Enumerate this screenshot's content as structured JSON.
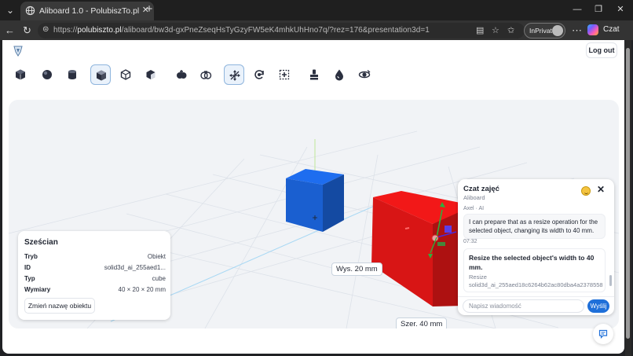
{
  "browser": {
    "tab_title": "Aliboard 1.0 - PolubiszTo.pl",
    "url_host": "polubiszto.pl",
    "url_prefix": "https://",
    "url_path": "/aliboard/bw3d-gxPneZseqHsTyGzyFW5eK4mhkUhHno7q/?rez=176&presentation3d=1",
    "inprivate_label": "InPrivate",
    "copilot_label": "Czat"
  },
  "header": {
    "logout_label": "Log out"
  },
  "toolbar": {
    "tools": [
      {
        "name": "box-icon",
        "active": false
      },
      {
        "name": "sphere-icon",
        "active": false
      },
      {
        "name": "cylinder-icon",
        "active": false
      },
      {
        "name": "cube-icon",
        "active": true
      },
      {
        "name": "cube-outline-icon",
        "active": false
      },
      {
        "name": "cube-variant-icon",
        "active": false
      },
      {
        "name": "union-icon",
        "active": false
      },
      {
        "name": "subtract-icon",
        "active": false
      },
      {
        "name": "move-icon",
        "active": true
      },
      {
        "name": "rotate-icon",
        "active": false
      },
      {
        "name": "scale-icon",
        "active": false
      },
      {
        "name": "paint-icon",
        "active": false
      },
      {
        "name": "drop-icon",
        "active": false
      },
      {
        "name": "orbit-icon",
        "active": false
      }
    ]
  },
  "viewport": {
    "height_label": "Wys. 20 mm",
    "width_label": "Szer. 40 mm",
    "cube_color": "#1a5fd0",
    "box_color": "#d81515"
  },
  "info_panel": {
    "title": "Sześcian",
    "rows": [
      {
        "key": "Tryb",
        "value": "Obiekt"
      },
      {
        "key": "ID",
        "value": "solid3d_ai_255aed1..."
      },
      {
        "key": "Typ",
        "value": "cube"
      },
      {
        "key": "Wymiary",
        "value": "40 × 20 × 20 mm"
      }
    ],
    "rename_label": "Zmień nazwę obiektu"
  },
  "chat": {
    "title": "Czat zajęć",
    "subtitle": "Aliboard",
    "message_author": "Axel · AI",
    "message_text": "I can prepare that as a resize operation for the selected object, changing its width to 40 mm.",
    "message_time": "07:32",
    "action_title": "Resize the selected object's width to 40 mm.",
    "action_type": "Resize",
    "action_target": "solid3d_ai_255aed18c6264b62ac80dba4a2378558",
    "input_placeholder": "Napisz wiadomość",
    "send_label": "Wyślij"
  },
  "colors": {
    "accent": "#1e6fd9",
    "active_tool_bg": "#eaf2fb"
  }
}
